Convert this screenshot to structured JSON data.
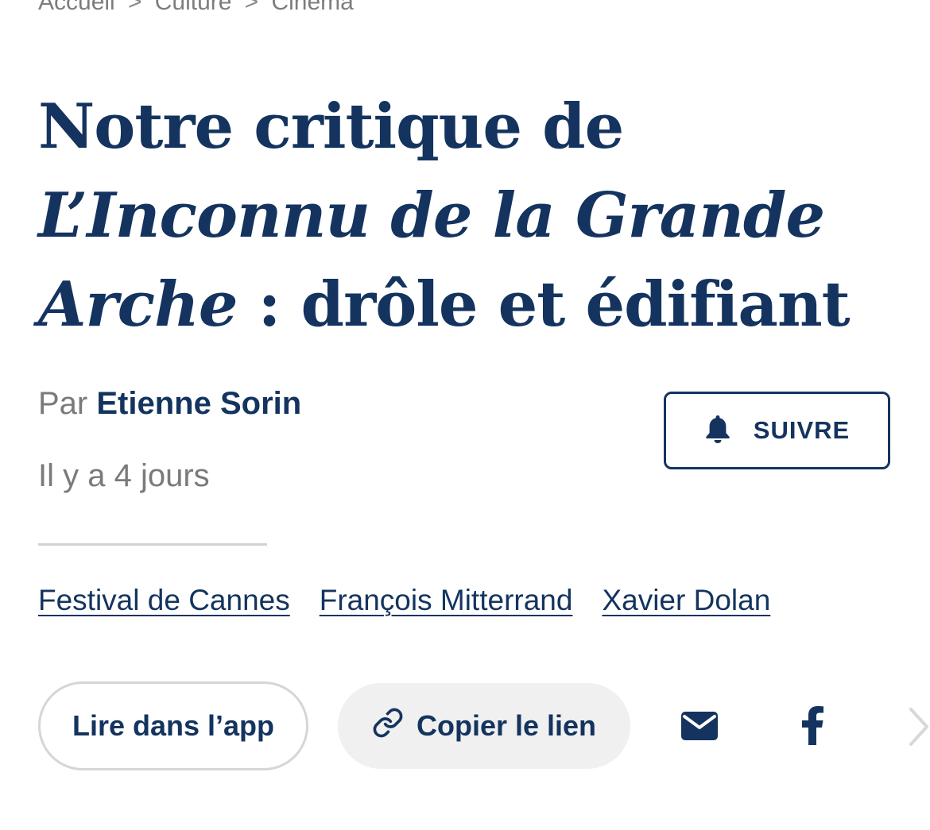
{
  "breadcrumb": {
    "items": [
      "Accueil",
      "Culture",
      "Cinéma"
    ],
    "separator": ">"
  },
  "article": {
    "title_line1": "Notre critique de",
    "title_italic": "L’Inconnu de la Grande Arche",
    "title_rest": " : drôle et édifiant",
    "byline_prefix": "Par",
    "author": "Etienne Sorin",
    "date": "Il y a 4 jours"
  },
  "follow": {
    "label": "SUIVRE",
    "icon": "bell-icon"
  },
  "tags": [
    "Festival de Cannes",
    "François Mitterrand",
    "Xavier Dolan"
  ],
  "share": {
    "app_label": "Lire dans l’app",
    "copy_label": "Copier le lien",
    "copy_icon": "link-icon",
    "mail_icon": "mail-icon",
    "facebook_icon": "facebook-icon",
    "next_icon": "chevron-right-icon"
  },
  "colors": {
    "brand": "#14345f",
    "muted": "#7a7a7a",
    "pill_bg": "#f0f0f0",
    "divider": "#d2d2d2"
  }
}
